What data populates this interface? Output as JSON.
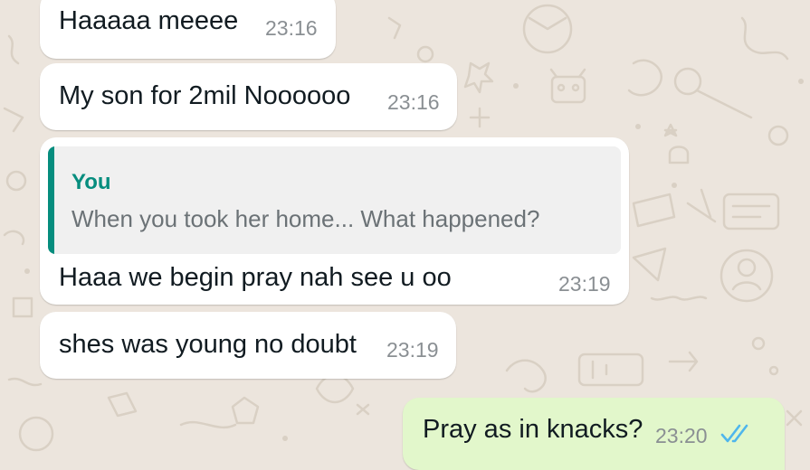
{
  "theme": {
    "wallpaper": "#ece5dd",
    "incoming_bubble": "#ffffff",
    "outgoing_bubble": "#e2f7cb",
    "quote_accent": "#068d7e",
    "read_ticks": "#4fb6ec"
  },
  "messages": [
    {
      "direction": "incoming",
      "text": "Haaaaa meeee",
      "time": "23:16"
    },
    {
      "direction": "incoming",
      "text": "My son for 2mil Noooooo",
      "time": "23:16"
    },
    {
      "direction": "incoming",
      "quoted": {
        "author": "You",
        "text": "When you took her home... What happened?"
      },
      "text": "Haaa we begin pray nah see u oo",
      "time": "23:19"
    },
    {
      "direction": "incoming",
      "text": "shes was young no doubt",
      "time": "23:19"
    },
    {
      "direction": "outgoing",
      "text": "Pray as in knacks?",
      "time": "23:20",
      "status_icon": "double-check-read-icon"
    }
  ]
}
